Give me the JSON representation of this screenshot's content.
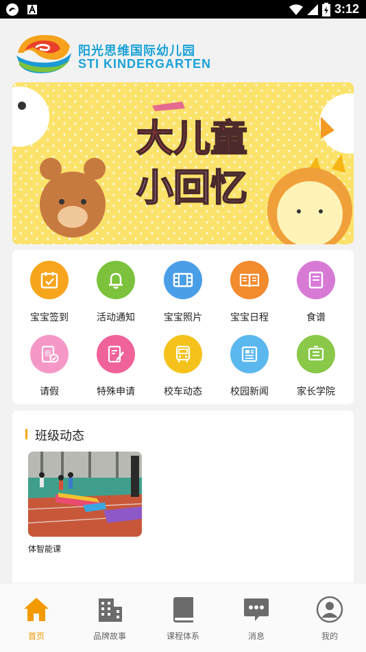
{
  "status_bar": {
    "time": "3:12"
  },
  "logo": {
    "name_cn": "阳光思维国际幼儿园",
    "name_en": "STI KINDERGARTEN"
  },
  "banner": {
    "title_line1": "大儿童",
    "title_line2": "小回忆",
    "slide_count": 4,
    "active_slide": 4
  },
  "menu": [
    {
      "label": "宝宝签到",
      "icon": "calendar-check-icon",
      "color": "#f7a51c"
    },
    {
      "label": "活动通知",
      "icon": "bell-icon",
      "color": "#7cc23c"
    },
    {
      "label": "宝宝照片",
      "icon": "film-icon",
      "color": "#4a9ee8"
    },
    {
      "label": "宝宝日程",
      "icon": "book-icon",
      "color": "#f28a2e"
    },
    {
      "label": "食谱",
      "icon": "recipe-book-icon",
      "color": "#d77ad6"
    },
    {
      "label": "请假",
      "icon": "leave-request-icon",
      "color": "#f598c8"
    },
    {
      "label": "特殊申请",
      "icon": "edit-form-icon",
      "color": "#f0629a"
    },
    {
      "label": "校车动态",
      "icon": "school-bus-icon",
      "color": "#f4c21a"
    },
    {
      "label": "校园新闻",
      "icon": "newspaper-icon",
      "color": "#5bb8ee"
    },
    {
      "label": "家长学院",
      "icon": "blackboard-icon",
      "color": "#8ac84a"
    }
  ],
  "class_news": {
    "title": "班级动态",
    "items": [
      {
        "caption": "体智能课"
      }
    ]
  },
  "tabbar": {
    "tabs": [
      {
        "label": "首页",
        "icon": "home-icon",
        "active": true
      },
      {
        "label": "品牌故事",
        "icon": "building-icon",
        "active": false
      },
      {
        "label": "课程体系",
        "icon": "book-closed-icon",
        "active": false
      },
      {
        "label": "消息",
        "icon": "chat-bubble-icon",
        "active": false
      },
      {
        "label": "我的",
        "icon": "user-icon",
        "active": false
      }
    ],
    "active_color": "#f39a00",
    "inactive_color": "#6b6b6b"
  }
}
